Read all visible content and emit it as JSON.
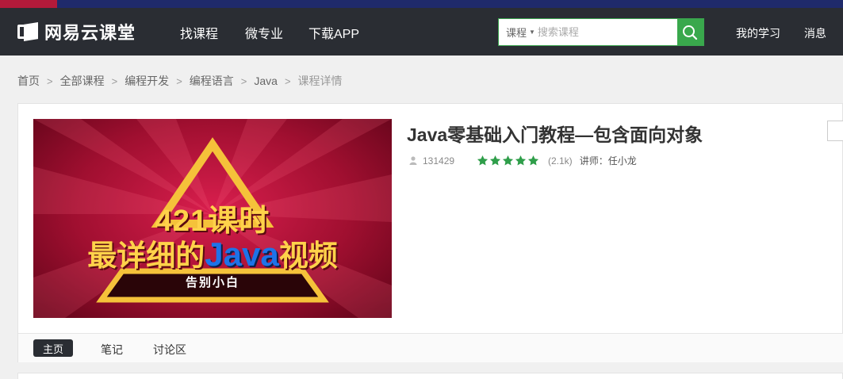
{
  "brand": {
    "name": "网易云课堂"
  },
  "nav": {
    "links": [
      "找课程",
      "微专业",
      "下载APP"
    ],
    "search": {
      "category": "课程",
      "placeholder": "搜索课程"
    },
    "right": [
      "我的学习",
      "消息"
    ]
  },
  "breadcrumb": [
    "首页",
    "全部课程",
    "编程开发",
    "编程语言",
    "Java",
    "课程详情"
  ],
  "course": {
    "title": "Java零基础入门教程—包含面向对象",
    "students": "131429",
    "rating_stars": 5,
    "rating_count": "(2.1k)",
    "teacher": "讲师：任小龙",
    "cover": {
      "line1": "421课时",
      "line2_before": "最详细的",
      "line2_java": "Java",
      "line2_after": "视频",
      "line3": "告别小白"
    }
  },
  "tabs": [
    "主页",
    "笔记",
    "讨论区"
  ],
  "colors": {
    "navbar": "#2a2d33",
    "accent_green": "#39a84c",
    "star_green": "#2f9e4a",
    "cover_red": "#c0153f"
  }
}
